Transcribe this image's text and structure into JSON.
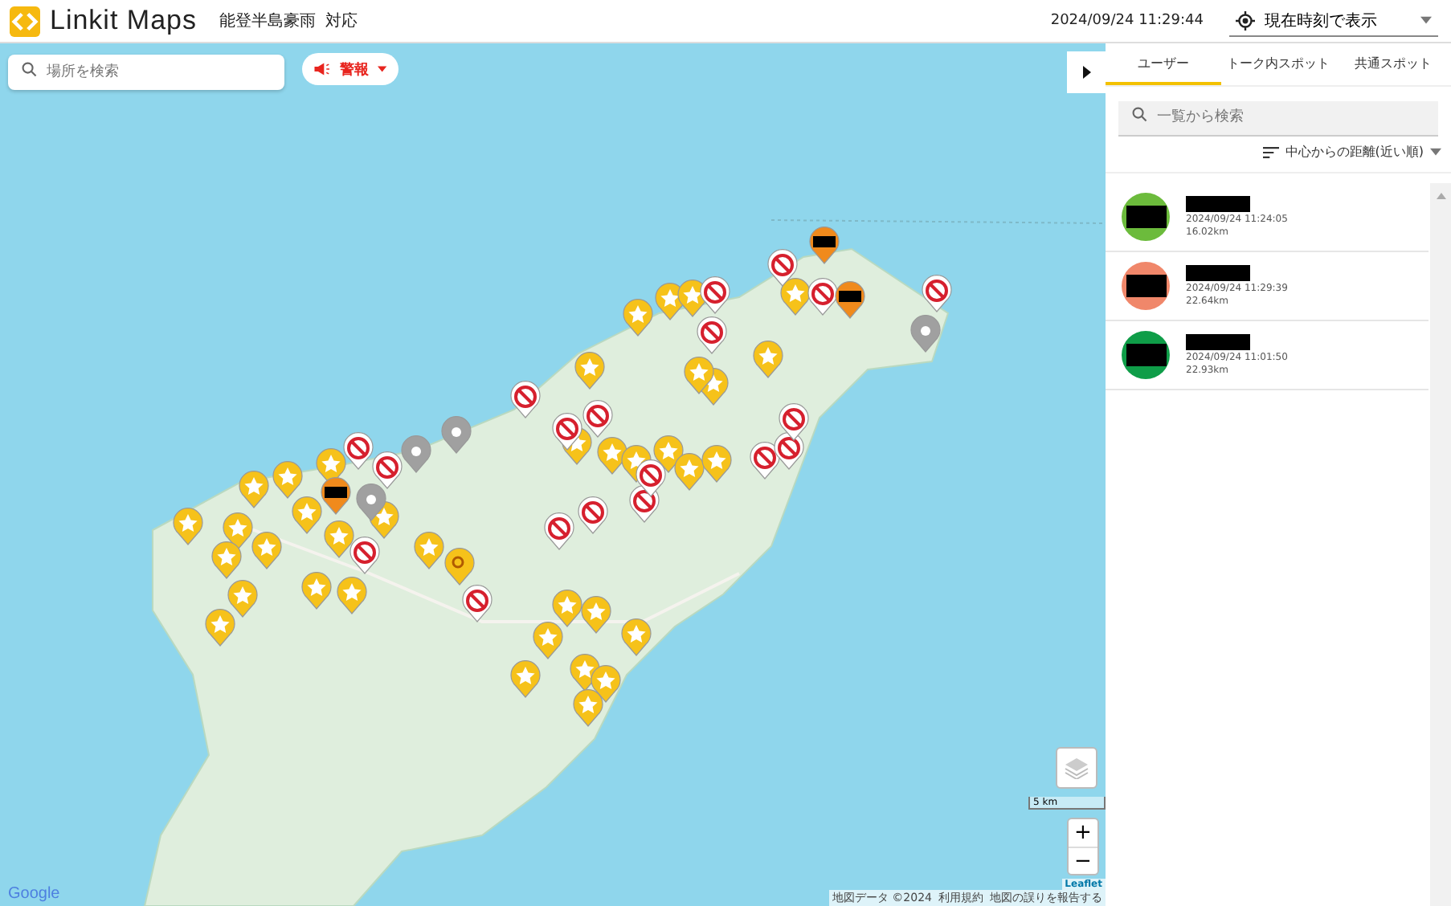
{
  "header": {
    "logo": "Linkit Maps",
    "event": "能登半島豪雨",
    "status": "対応",
    "datetime": "2024/09/24 11:29:44",
    "time_mode": "現在時刻で表示"
  },
  "map": {
    "search": {
      "placeholder": "場所を検索"
    },
    "alert_button": "警報",
    "scale": "5 km",
    "zoom_in": "+",
    "zoom_out": "−",
    "attribution": [
      "Leaflet",
      "地図データ ©2024",
      "利用規約",
      "地図の誤りを報告する"
    ],
    "google": "Google"
  },
  "panel": {
    "tabs": [
      {
        "label": "ユーザー",
        "selected": true
      },
      {
        "label": "トーク内スポット",
        "selected": false
      },
      {
        "label": "共通スポット",
        "selected": false
      }
    ],
    "search": {
      "placeholder": "一覧から検索"
    },
    "sort": "中心からの距離(近い順)",
    "users": [
      {
        "color": "#6cbb3c",
        "time": "2024/09/24 11:24:05",
        "distance": "16.02km"
      },
      {
        "color": "#f0876a",
        "time": "2024/09/24 11:29:39",
        "distance": "22.64km"
      },
      {
        "color": "#0f9d48",
        "time": "2024/09/24 11:01:50",
        "distance": "22.93km"
      }
    ]
  }
}
